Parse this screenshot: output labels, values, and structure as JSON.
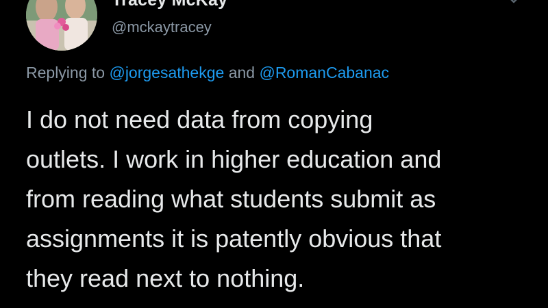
{
  "author": {
    "display_name": "Tracey McKay",
    "handle": "@mckaytracey",
    "avatar_icon": "profile-photo"
  },
  "reply": {
    "prefix": "Replying to",
    "mention_1": "@jorgesathekge",
    "conjunction": "and",
    "mention_2": "@RomanCabanac"
  },
  "tweet": {
    "lines": [
      "I do not need data from copying",
      "outlets. I work in higher education and",
      "from reading what students submit as",
      "assignments it is patently obvious that",
      "they read next to nothing."
    ]
  },
  "icons": {
    "more": "chevron-down-icon"
  },
  "colors": {
    "background": "#000000",
    "text": "#e7e9ea",
    "secondary_text": "#8b98a5",
    "link": "#1d9bf0"
  }
}
